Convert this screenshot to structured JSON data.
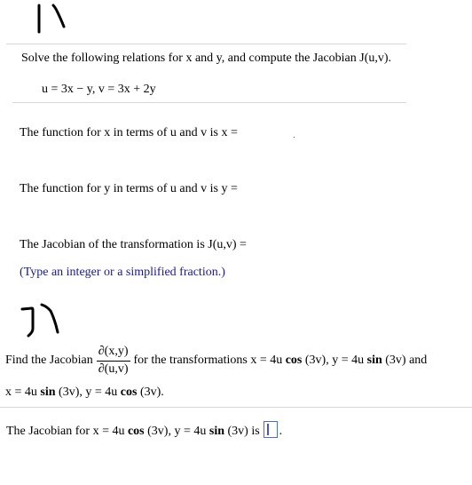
{
  "annotations": {
    "problem_1_mark": "1)",
    "problem_2_mark": "2)"
  },
  "problem1": {
    "instruction": "Solve the following relations for x and y, and compute the Jacobian J(u,v).",
    "equations": "u = 3x − y, v = 3x + 2y",
    "x_prompt": "The function for x in terms of u and v is x =",
    "x_answer": "",
    "y_prompt": "The function for y in terms of u and v is y =",
    "y_answer": "",
    "jacobian_prompt": "The Jacobian of the transformation is J(u,v) =",
    "jacobian_answer": "",
    "hint": "(Type an integer or a simplified fraction.)"
  },
  "problem2": {
    "intro": "Find the Jacobian",
    "frac_num": "∂(x,y)",
    "frac_den": "∂(u,v)",
    "after_frac": "for the transformations x = 4u",
    "t1_cos": "cos",
    "t1_mid": "(3v), y = 4u",
    "t1_sin": "sin",
    "t1_end": "(3v) and",
    "line2_start": "x = 4u",
    "t2_sin": "sin",
    "t2_mid": "(3v), y = 4u",
    "t2_cos": "cos",
    "t2_end": "(3v).",
    "answer_prefix": "The Jacobian for x = 4u",
    "ans_cos": "cos",
    "ans_mid": "(3v), y = 4u",
    "ans_sin": "sin",
    "ans_end": "(3v) is",
    "answer_value": "",
    "answer_suffix": "."
  }
}
